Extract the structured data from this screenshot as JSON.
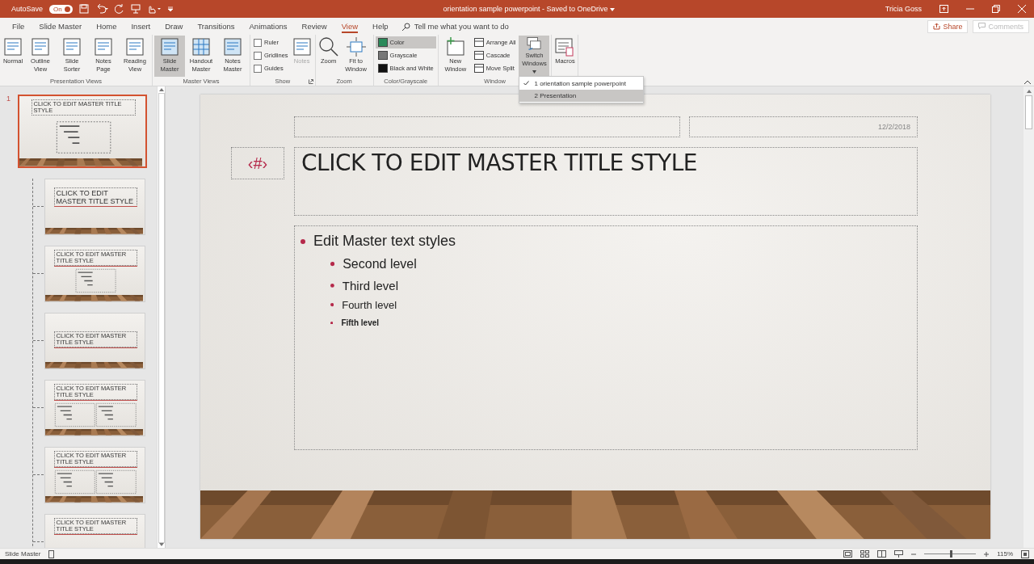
{
  "title_bar": {
    "autosave_label": "AutoSave",
    "autosave": {
      "label": "On",
      "on": true
    },
    "title": "orientation sample powerpoint - Saved to OneDrive",
    "user": "Tricia Goss"
  },
  "tabs": [
    {
      "label": "File",
      "selected": false
    },
    {
      "label": "Slide Master",
      "selected": false
    },
    {
      "label": "Home",
      "selected": false
    },
    {
      "label": "Insert",
      "selected": false
    },
    {
      "label": "Draw",
      "selected": false
    },
    {
      "label": "Transitions",
      "selected": false
    },
    {
      "label": "Animations",
      "selected": false
    },
    {
      "label": "Review",
      "selected": false
    },
    {
      "label": "View",
      "selected": true
    },
    {
      "label": "Help",
      "selected": false
    }
  ],
  "search": {
    "placeholder": "Tell me what you want to do"
  },
  "share": {
    "label": "Share"
  },
  "comments": {
    "label": "Comments",
    "disabled": true
  },
  "ribbon": {
    "groups": [
      {
        "label": "Presentation Views",
        "items": [
          {
            "kind": "large",
            "label": "Normal",
            "selected": false,
            "disabled": false
          },
          {
            "kind": "large",
            "label": "Outline View",
            "selected": false,
            "disabled": false
          },
          {
            "kind": "large",
            "label": "Slide Sorter",
            "selected": false,
            "disabled": false
          },
          {
            "kind": "large",
            "label": "Notes Page",
            "selected": false,
            "disabled": false
          },
          {
            "kind": "large",
            "label": "Reading View",
            "selected": false,
            "disabled": false
          }
        ]
      },
      {
        "label": "Master Views",
        "items": [
          {
            "kind": "large",
            "label": "Slide Master",
            "selected": true,
            "disabled": false
          },
          {
            "kind": "large",
            "label": "Handout Master",
            "selected": false,
            "disabled": false
          },
          {
            "kind": "large",
            "label": "Notes Master",
            "selected": false,
            "disabled": false
          }
        ]
      },
      {
        "label": "Show",
        "launcher": true,
        "items": [
          {
            "kind": "check",
            "label": "Ruler",
            "checked": false
          },
          {
            "kind": "check",
            "label": "Gridlines",
            "checked": false
          },
          {
            "kind": "check",
            "label": "Guides",
            "checked": false
          },
          {
            "kind": "large",
            "label": "Notes",
            "selected": false,
            "disabled": true
          }
        ]
      },
      {
        "label": "Zoom",
        "items": [
          {
            "kind": "large",
            "label": "Zoom",
            "selected": false,
            "disabled": false
          },
          {
            "kind": "large",
            "label": "Fit to Window",
            "selected": false,
            "disabled": false
          }
        ]
      },
      {
        "label": "Color/Grayscale",
        "items": [
          {
            "kind": "small",
            "label": "Color",
            "selected": true
          },
          {
            "kind": "small",
            "label": "Grayscale",
            "selected": false
          },
          {
            "kind": "small",
            "label": "Black and White",
            "selected": false
          }
        ]
      },
      {
        "label": "Window",
        "items": [
          {
            "kind": "large",
            "label": "New Window",
            "selected": false,
            "disabled": false
          },
          {
            "kind": "small",
            "label": "Arrange All",
            "selected": false
          },
          {
            "kind": "small",
            "label": "Cascade",
            "selected": false
          },
          {
            "kind": "small",
            "label": "Move Split",
            "selected": false
          },
          {
            "kind": "large",
            "label": "Switch Windows",
            "selected": true,
            "disabled": false,
            "menu": true
          }
        ]
      },
      {
        "items": [
          {
            "kind": "large",
            "label": "Macros",
            "selected": false,
            "disabled": false
          }
        ]
      }
    ]
  },
  "windows_menu": [
    {
      "label": "1 orientation sample powerpoint",
      "checked": true,
      "selected": false
    },
    {
      "label": "2 Presentation",
      "checked": false,
      "selected": true
    }
  ],
  "thumbnails": [
    {
      "number": "1",
      "kind": "master",
      "title": "CLICK TO EDIT MASTER TITLE STYLE",
      "selected": true,
      "children": [
        {
          "kind": "title",
          "title": "CLICK TO EDIT MASTER TITLE STYLE",
          "selected": false
        },
        {
          "kind": "content",
          "title": "CLICK TO EDIT MASTER TITLE STYLE",
          "selected": false
        },
        {
          "kind": "section",
          "title": "CLICK TO EDIT MASTER TITLE STYLE",
          "selected": false
        },
        {
          "kind": "two",
          "title": "CLICK TO EDIT MASTER TITLE STYLE",
          "selected": false
        },
        {
          "kind": "comparison",
          "title": "CLICK TO EDIT MASTER TITLE STYLE",
          "selected": false
        },
        {
          "kind": "title-only",
          "title": "CLICK TO EDIT MASTER TITLE STYLE",
          "selected": false
        }
      ]
    }
  ],
  "slide": {
    "date": "12/2/2018",
    "number": "‹#›",
    "title": "CLICK TO EDIT MASTER TITLE STYLE",
    "bullets": [
      {
        "text": "Edit Master text styles",
        "children": [
          {
            "text": "Second level",
            "children": [
              {
                "text": "Third level",
                "children": [
                  {
                    "text": "Fourth level",
                    "children": [
                      {
                        "text": "Fifth level"
                      }
                    ]
                  }
                ]
              }
            ]
          }
        ]
      }
    ]
  },
  "status_bar": {
    "view": "Slide Master",
    "zoom": {
      "level": 0.5
    },
    "zoom_reading": "115%"
  }
}
